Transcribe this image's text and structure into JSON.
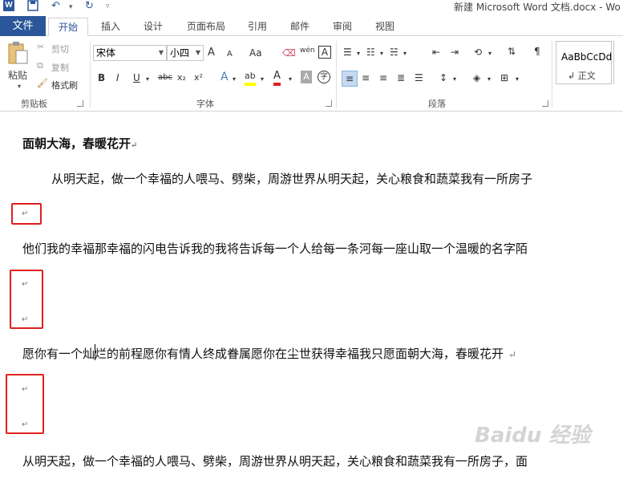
{
  "titlebar": {
    "title": "新建 Microsoft Word 文档.docx - Wo"
  },
  "tabs": {
    "file": "文件",
    "items": [
      "开始",
      "插入",
      "设计",
      "页面布局",
      "引用",
      "邮件",
      "审阅",
      "视图"
    ],
    "active": "开始"
  },
  "clipboard": {
    "paste": "粘贴",
    "cut": "剪切",
    "copy": "复制",
    "format_painter": "格式刷",
    "label": "剪贴板"
  },
  "font": {
    "name": "宋体",
    "size": "小四",
    "label": "字体",
    "grow": "A",
    "shrink": "A",
    "case": "Aa",
    "phonetic": "wén",
    "border_char": "A",
    "bold": "B",
    "italic": "I",
    "underline": "U",
    "strike": "abc",
    "subscript": "x₂",
    "superscript": "x²",
    "effects": "A",
    "highlight": "ab",
    "color": "A",
    "shading": "A",
    "enclose": "字"
  },
  "paragraph": {
    "label": "段落"
  },
  "styles": {
    "sample": "AaBbCcDd",
    "name": "正文"
  },
  "document": {
    "heading": "面朝大海，春暖花开",
    "para1": "从明天起，做一个幸福的人喂马、劈柴，周游世界从明天起，关心粮食和蔬菜我有一所房子",
    "para2": "他们我的幸福那幸福的闪电告诉我的我将告诉每一个人给每一条河每一座山取一个温暖的名字陌",
    "para3": "愿你有一个灿烂的前程愿你有情人终成眷属愿你在尘世获得幸福我只愿面朝大海，春暖花开",
    "para4": "从明天起，做一个幸福的人喂马、劈柴，周游世界从明天起，关心粮食和蔬菜我有一所房子，面",
    "para_mark": "↵",
    "watermark": "Baidu 经验"
  },
  "colors": {
    "accent": "#2b579a",
    "highlight_box": "#e02020"
  }
}
